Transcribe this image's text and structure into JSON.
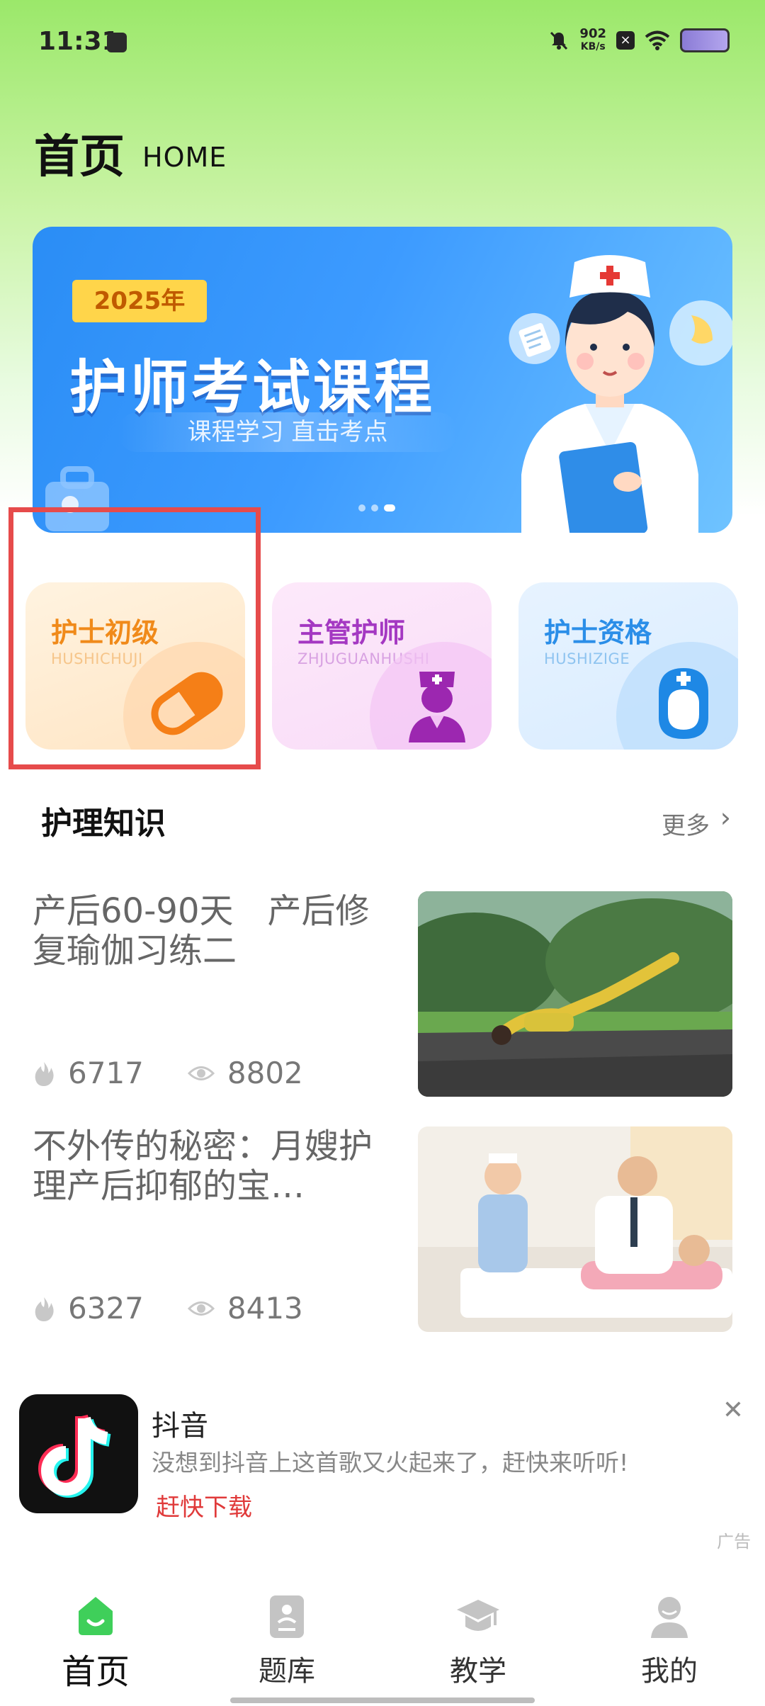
{
  "status_bar": {
    "time": "11:31",
    "net_speed": "902",
    "net_unit": "KB/s"
  },
  "header": {
    "title": "首页",
    "subtitle": "HOME"
  },
  "banner": {
    "year_badge": "2025年",
    "title": "护师考试课程",
    "subtitle": "课程学习 直击考点"
  },
  "categories": [
    {
      "title": "护士初级",
      "subtitle": "HUSHICHUJI",
      "icon": "pill-icon",
      "color": "#f08a1a"
    },
    {
      "title": "主管护师",
      "subtitle": "ZHJUGUANHUSHI",
      "icon": "nurse-avatar-icon",
      "color": "#a438c2"
    },
    {
      "title": "护士资格",
      "subtitle": "HUSHIZIGE",
      "icon": "nurse-cap-icon",
      "color": "#2b8ee8"
    }
  ],
  "section": {
    "title": "护理知识",
    "more": "更多"
  },
  "articles": [
    {
      "title": "产后60-90天　产后修复瑜伽习练二",
      "likes": "6717",
      "views": "8802"
    },
    {
      "title": "不外传的秘密：月嫂护理产后抑郁的宝…",
      "likes": "6327",
      "views": "8413"
    }
  ],
  "ad": {
    "app_name": "抖音",
    "description": "没想到抖音上这首歌又火起来了，赶快来听听!",
    "cta": "赶快下载",
    "tag": "广告"
  },
  "nav": [
    {
      "label": "首页",
      "icon": "home-icon",
      "active": true
    },
    {
      "label": "题库",
      "icon": "question-bank-icon",
      "active": false
    },
    {
      "label": "教学",
      "icon": "graduation-cap-icon",
      "active": false
    },
    {
      "label": "我的",
      "icon": "profile-icon",
      "active": false
    }
  ],
  "colors": {
    "accent_green": "#3fcf5a",
    "highlight_red": "#e64b4b"
  }
}
